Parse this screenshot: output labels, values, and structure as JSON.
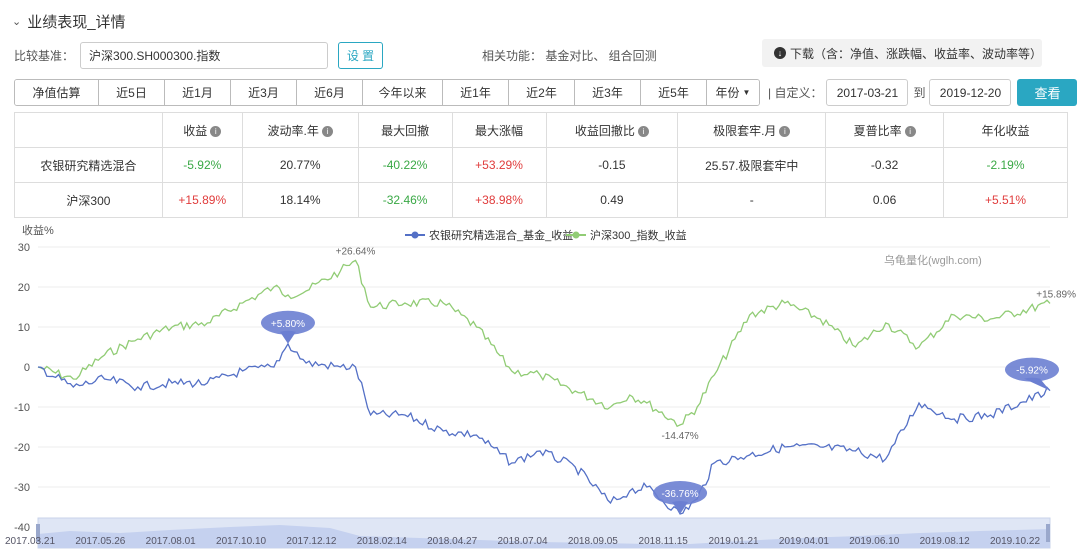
{
  "header": {
    "chevron": "⌄",
    "title": "业绩表现_详情"
  },
  "benchmark": {
    "label": "比较基准：",
    "value": "沪深300.SH000300.指数",
    "setup_button": "设 置"
  },
  "related": {
    "text": "相关功能： 基金对比、 组合回测"
  },
  "download": {
    "text": "下载（含：净值、涨跌幅、收益率、波动率等）"
  },
  "periods": [
    "净值估算",
    "近5日",
    "近1月",
    "近3月",
    "近6月",
    "今年以来",
    "近1年",
    "近2年",
    "近3年",
    "近5年",
    "年份"
  ],
  "custom_range": {
    "label": "| 自定义：",
    "start": "2017-03-21",
    "to_label": "到",
    "end": "2019-12-20",
    "query_button": "查看"
  },
  "stats_table": {
    "headers": [
      "",
      "收益",
      "波动率.年",
      "最大回撤",
      "最大涨幅",
      "收益回撤比",
      "极限套牢.月",
      "夏普比率",
      "年化收益"
    ],
    "rows": [
      {
        "name": "农银研究精选混合",
        "cells": [
          "-5.92%",
          "20.77%",
          "-40.22%",
          "+53.29%",
          "-0.15",
          "25.57.极限套牢中",
          "-0.32",
          "-2.19%"
        ]
      },
      {
        "name": "沪深300",
        "cells": [
          "+15.89%",
          "18.14%",
          "-32.46%",
          "+38.98%",
          "0.49",
          "-",
          "0.06",
          "+5.51%"
        ]
      }
    ]
  },
  "chart_data": {
    "type": "line",
    "ylabel": "收益%",
    "ylim": [
      -40,
      30
    ],
    "yticks": [
      30,
      20,
      10,
      0,
      -10,
      -20,
      -30,
      -40
    ],
    "xticks": [
      "2017.03.21",
      "2017.05.26",
      "2017.08.01",
      "2017.10.10",
      "2017.12.12",
      "2018.02.14",
      "2018.04.27",
      "2018.07.04",
      "2018.09.05",
      "2018.11.15",
      "2019.01.21",
      "2019.04.01",
      "2019.06.10",
      "2019.08.12",
      "2019.10.22"
    ],
    "watermark": "乌龟量化(wglh.com)",
    "colors": {
      "fund": "#5470c6",
      "index": "#91cc75",
      "marker": "#6b7fd1"
    },
    "series": [
      {
        "name": "农银研究精选混合_基金_收益",
        "x": [
          "2017.03.21",
          "2017.04.25",
          "2017.05.26",
          "2017.06.28",
          "2017.08.01",
          "2017.09.05",
          "2017.10.10",
          "2017.11.10",
          "2017.11.24",
          "2017.12.12",
          "2018.01.15",
          "2018.01.30",
          "2018.02.14",
          "2018.03.20",
          "2018.04.27",
          "2018.05.30",
          "2018.07.04",
          "2018.08.01",
          "2018.09.05",
          "2018.10.10",
          "2018.10.29",
          "2018.11.15",
          "2018.12.18",
          "2019.01.04",
          "2019.01.21",
          "2019.02.25",
          "2019.04.01",
          "2019.05.06",
          "2019.06.10",
          "2019.07.10",
          "2019.08.12",
          "2019.09.16",
          "2019.10.22",
          "2019.12.20"
        ],
        "y": [
          0,
          -5,
          -3,
          -5,
          -4,
          -4,
          -1,
          0,
          5.8,
          1,
          0,
          0,
          -12,
          -12,
          -16,
          -17,
          -24,
          -21,
          -25,
          -34,
          -31,
          -30,
          -36.76,
          -33,
          -24,
          -22,
          -20,
          -20,
          -21,
          -23,
          -9,
          -13,
          -12,
          -5.92
        ]
      },
      {
        "name": "沪深300_指数_收益",
        "x": [
          "2017.03.21",
          "2017.04.25",
          "2017.05.26",
          "2017.06.28",
          "2017.08.01",
          "2017.09.05",
          "2017.10.10",
          "2017.11.10",
          "2017.11.24",
          "2017.12.12",
          "2018.01.15",
          "2018.01.30",
          "2018.02.14",
          "2018.03.20",
          "2018.04.27",
          "2018.05.30",
          "2018.07.04",
          "2018.08.01",
          "2018.09.05",
          "2018.10.10",
          "2018.10.29",
          "2018.11.15",
          "2018.12.18",
          "2019.01.04",
          "2019.01.21",
          "2019.02.25",
          "2019.04.01",
          "2019.05.06",
          "2019.06.10",
          "2019.07.10",
          "2019.08.12",
          "2019.09.16",
          "2019.10.22",
          "2019.12.20"
        ],
        "y": [
          0,
          -3,
          3,
          7,
          10,
          11,
          16,
          20,
          18,
          19,
          24,
          26.64,
          15,
          16,
          16,
          10,
          -1,
          -2,
          -6,
          -10,
          -7,
          -9,
          -14.47,
          -10,
          -2,
          13,
          16,
          12,
          5,
          11,
          5,
          13,
          12,
          15.89
        ]
      }
    ],
    "annotations": [
      {
        "label": "+5.80%",
        "series": 0,
        "x": "2017.11.24",
        "y": 5.8
      },
      {
        "label": "+26.64%",
        "series": 1,
        "x": "2018.01.30",
        "y": 26.64
      },
      {
        "label": "-14.47%",
        "series": 1,
        "x": "2018.12.18",
        "y": -14.47
      },
      {
        "label": "-36.76%",
        "series": 0,
        "x": "2018.12.18",
        "y": -36.76
      },
      {
        "label": "+15.89%",
        "series": 1,
        "x": "2019.12.20",
        "y": 15.89
      },
      {
        "label": "-5.92%",
        "series": 0,
        "x": "2019.12.20",
        "y": -5.92
      }
    ]
  }
}
